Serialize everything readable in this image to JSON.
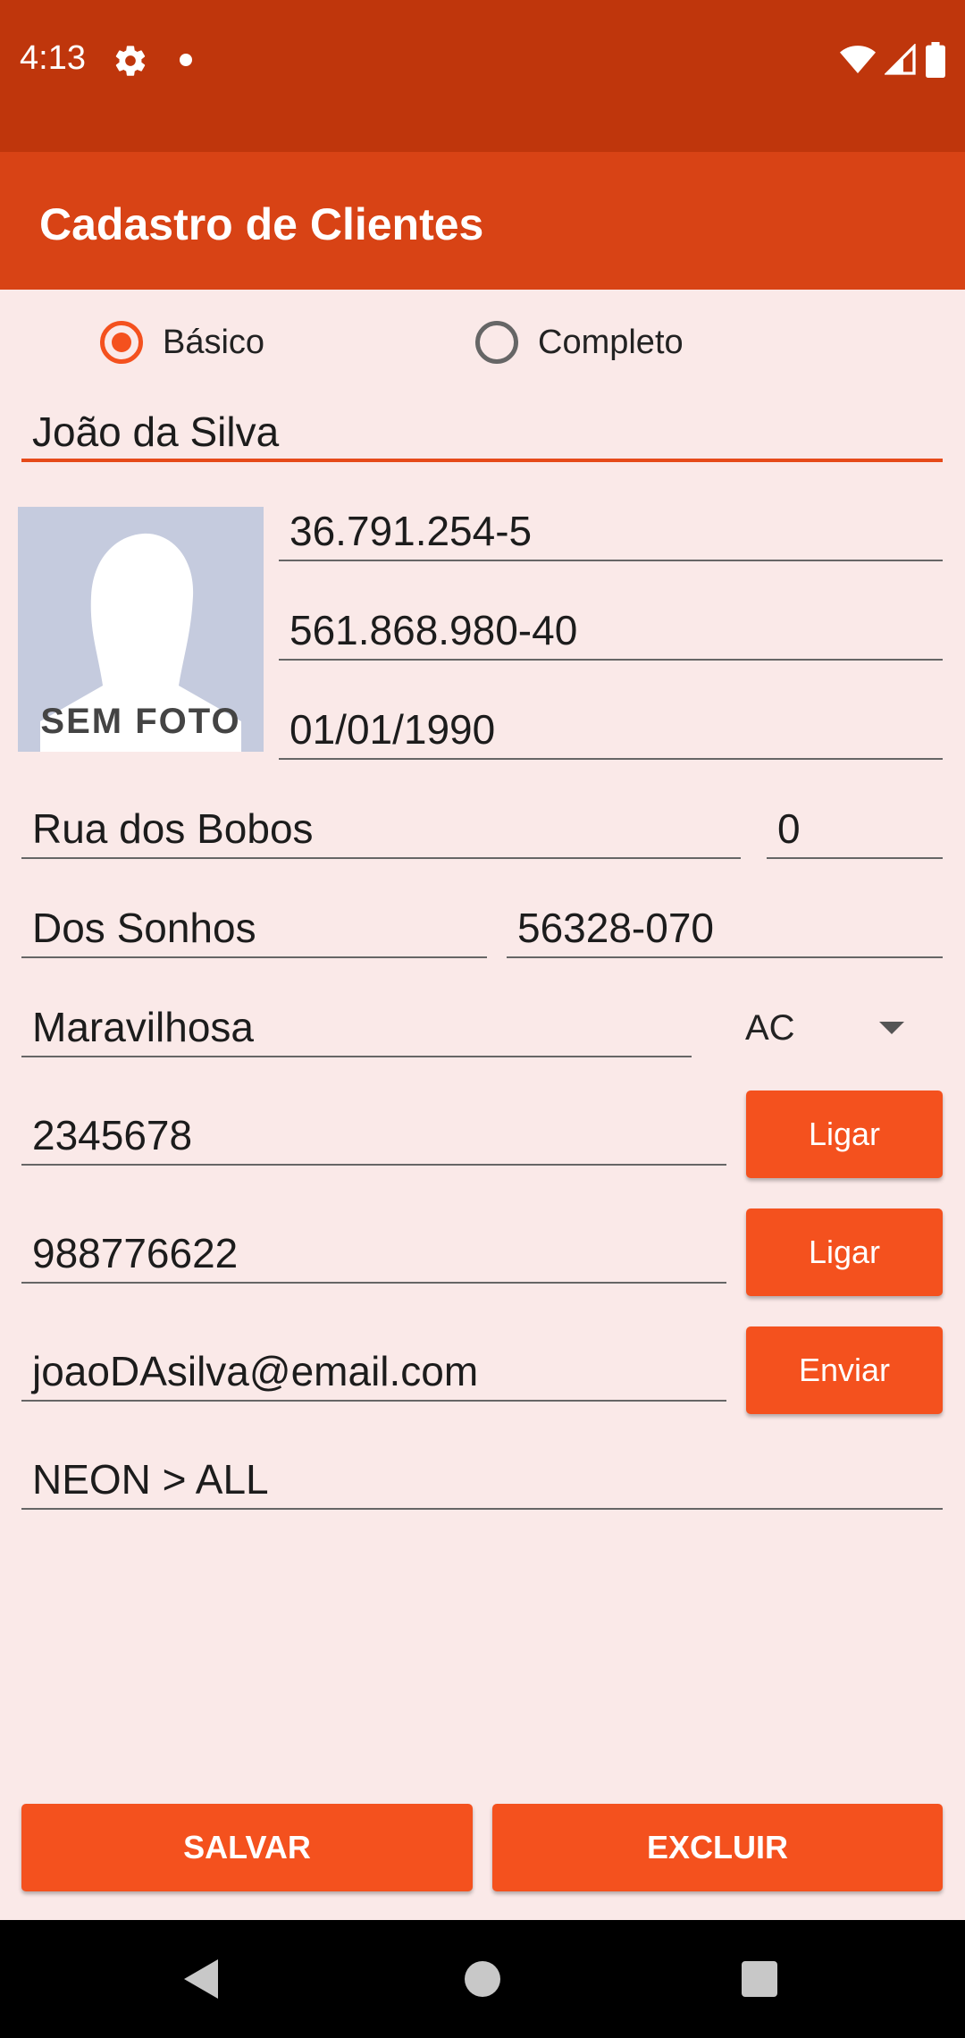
{
  "status_bar": {
    "time": "4:13",
    "icons": [
      "gear-icon",
      "notification-dot-icon",
      "wifi-icon",
      "signal-icon",
      "battery-icon"
    ]
  },
  "app_bar": {
    "title": "Cadastro de Clientes"
  },
  "mode": {
    "basic_label": "Básico",
    "complete_label": "Completo",
    "selected": "Básico"
  },
  "form": {
    "name": "João da Silva",
    "rg": "36.791.254-5",
    "cpf": "561.868.980-40",
    "birth_date": "01/01/1990",
    "street": "Rua dos Bobos",
    "number": "0",
    "neighborhood": "Dos Sonhos",
    "zip": "56328-070",
    "city": "Maravilhosa",
    "state": "AC",
    "phone": "2345678",
    "mobile": "988776622",
    "email": "joaoDAsilva@email.com",
    "notes": "NEON > ALL"
  },
  "photo": {
    "placeholder_text": "SEM FOTO"
  },
  "buttons": {
    "call_phone": "Ligar",
    "call_mobile": "Ligar",
    "send_email": "Enviar",
    "save": "SALVAR",
    "delete": "EXCLUIR"
  },
  "colors": {
    "status_bar": "#BF360C",
    "app_bar": "#D84315",
    "accent": "#F4511E",
    "background": "#FAE9E8"
  },
  "nav_bar": {
    "icons": [
      "back-icon",
      "home-icon",
      "recents-icon"
    ]
  }
}
